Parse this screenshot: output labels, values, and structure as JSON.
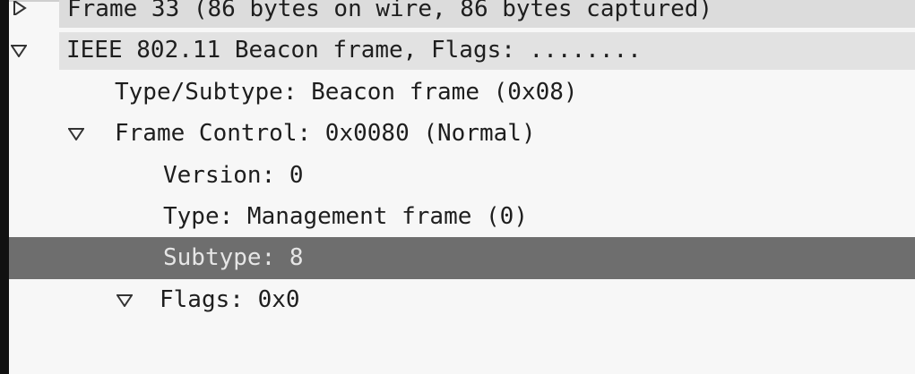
{
  "packet_details": {
    "rows": [
      {
        "label": "Frame 33 (86 bytes on wire, 86 bytes captured)",
        "expanded": false
      },
      {
        "label": "IEEE 802.11 Beacon frame, Flags: ........",
        "expanded": true
      },
      {
        "label": "Type/Subtype: Beacon frame (0x08)"
      },
      {
        "label": "Frame Control: 0x0080 (Normal)",
        "expanded": true
      },
      {
        "label": "Version: 0"
      },
      {
        "label": "Type: Management frame (0)"
      },
      {
        "label": "Subtype: 8",
        "selected": true
      },
      {
        "label": "Flags: 0x0",
        "expanded": true
      }
    ]
  },
  "colors": {
    "selected_row_bg": "#6e6e6e",
    "header_row_bg": "#e2e2e2",
    "pane_bg": "#f7f7f7"
  },
  "icons": {
    "collapsed": "triangle-right-icon",
    "expanded": "triangle-down-icon"
  }
}
